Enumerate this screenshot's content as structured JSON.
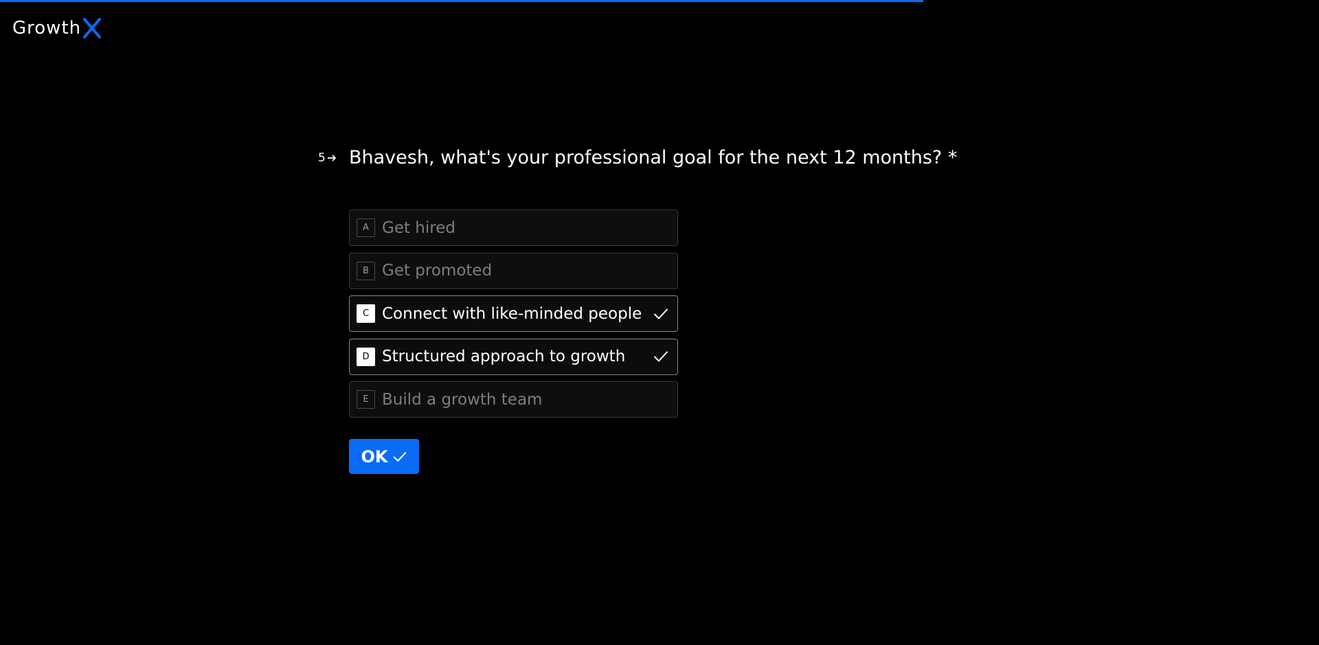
{
  "brand": {
    "name": "Growth",
    "mark_letter": "X",
    "accent_color": "#0a6cf5"
  },
  "progress": {
    "percent": 70
  },
  "question": {
    "number": "5",
    "text": "Bhavesh, what's your professional goal for the next 12 months? *"
  },
  "options": [
    {
      "key": "A",
      "label": "Get hired",
      "selected": false
    },
    {
      "key": "B",
      "label": "Get promoted",
      "selected": false
    },
    {
      "key": "C",
      "label": "Connect with like-minded people",
      "selected": true
    },
    {
      "key": "D",
      "label": "Structured approach to growth",
      "selected": true
    },
    {
      "key": "E",
      "label": "Build a growth team",
      "selected": false
    }
  ],
  "submit": {
    "label": "OK"
  },
  "icons": {
    "question_arrow": "arrow-right-icon",
    "option_check": "check-icon",
    "submit_check": "check-icon"
  }
}
